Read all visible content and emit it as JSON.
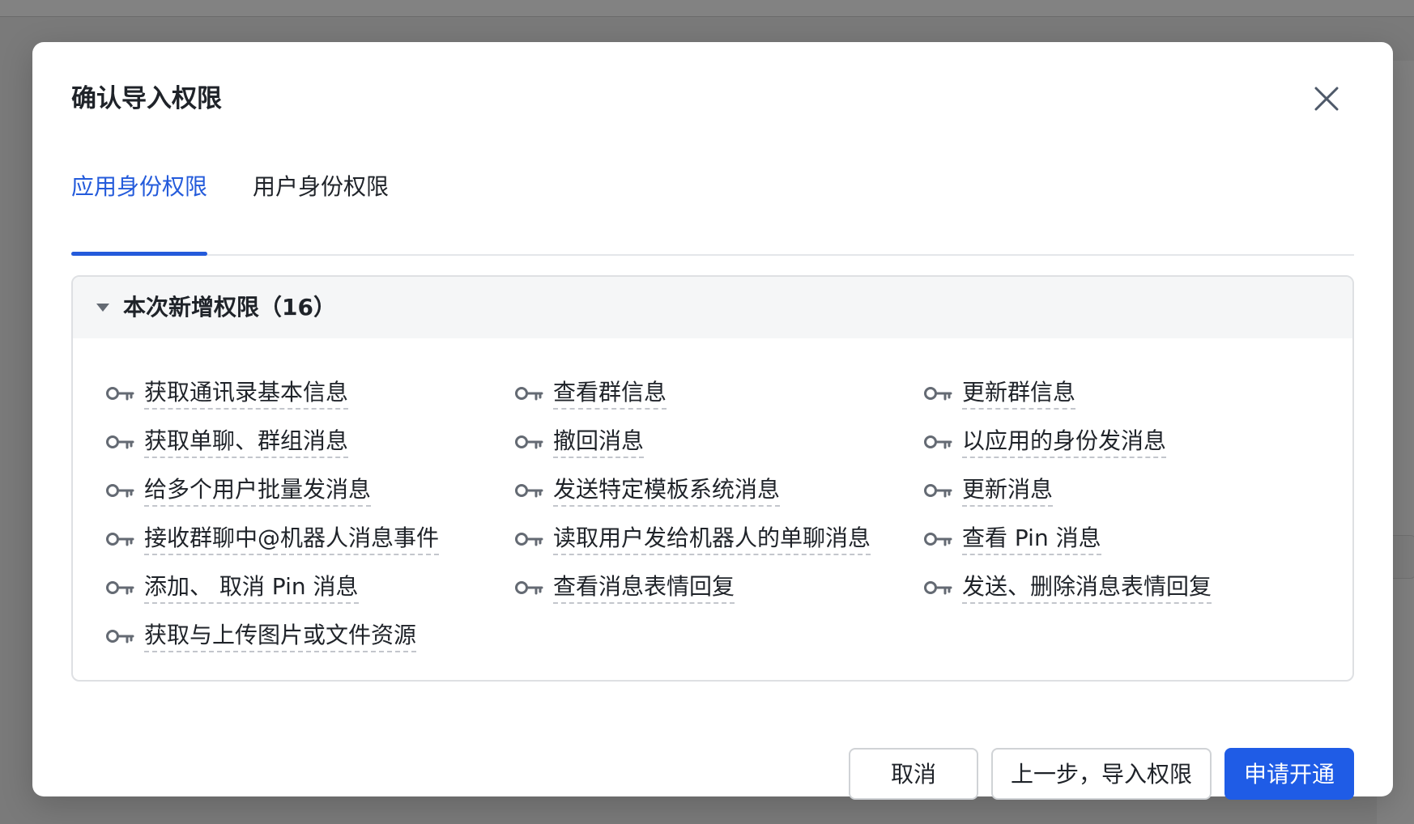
{
  "dialog": {
    "title": "确认导入权限"
  },
  "tabs": [
    {
      "label": "应用身份权限",
      "active": true
    },
    {
      "label": "用户身份权限",
      "active": false
    }
  ],
  "panel": {
    "title": "本次新增权限（16）",
    "icon": "caret-down-icon",
    "item_icon": "key-icon"
  },
  "permissions": [
    "获取通讯录基本信息",
    "查看群信息",
    "更新群信息",
    "获取单聊、群组消息",
    "撤回消息",
    "以应用的身份发消息",
    "给多个用户批量发消息",
    "发送特定模板系统消息",
    "更新消息",
    "接收群聊中@机器人消息事件",
    "读取用户发给机器人的单聊消息",
    "查看 Pin 消息",
    "添加、 取消 Pin 消息",
    "查看消息表情回复",
    "发送、删除消息表情回复",
    "获取与上传图片或文件资源"
  ],
  "buttons": {
    "cancel": "取消",
    "back": "上一步，导入权限",
    "apply": "申请开通"
  },
  "colors": {
    "accent": "#245bdb",
    "primary_button": "#1f5ce6",
    "text": "#1f2329",
    "key_icon": "#646a73",
    "overlay": "#7a7a7a"
  }
}
